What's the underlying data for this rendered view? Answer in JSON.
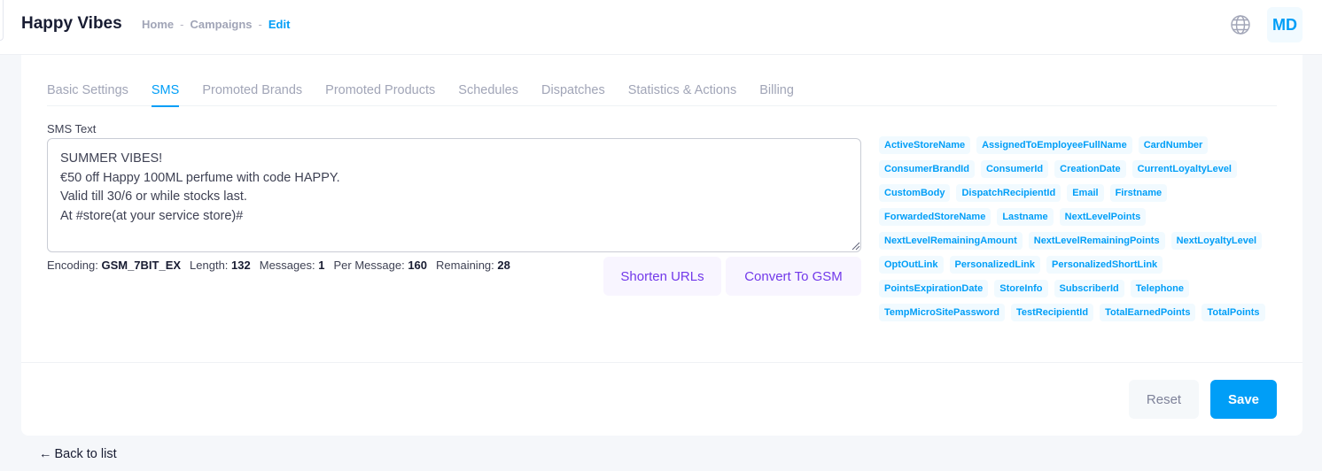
{
  "header": {
    "app_title": "Happy Vibes",
    "breadcrumb": [
      "Home",
      "Campaigns",
      "Edit"
    ],
    "separator": "-",
    "language_icon": "globe-icon",
    "avatar_initials": "MD"
  },
  "tabs": [
    {
      "label": "Basic Settings",
      "active": false
    },
    {
      "label": "SMS",
      "active": true
    },
    {
      "label": "Promoted Brands",
      "active": false
    },
    {
      "label": "Promoted Products",
      "active": false
    },
    {
      "label": "Schedules",
      "active": false
    },
    {
      "label": "Dispatches",
      "active": false
    },
    {
      "label": "Statistics & Actions",
      "active": false
    },
    {
      "label": "Billing",
      "active": false
    }
  ],
  "sms": {
    "label": "SMS Text",
    "text": "SUMMER VIBES!\n€50 off Happy 100ML perfume with code HAPPY.\nValid till 30/6 or while stocks last.\nAt #store(at your service store)#"
  },
  "stats": {
    "encoding_label": "Encoding:",
    "encoding_value": "GSM_7BIT_EX",
    "length_label": "Length:",
    "length_value": "132",
    "messages_label": "Messages:",
    "messages_value": "1",
    "per_message_label": "Per Message:",
    "per_message_value": "160",
    "remaining_label": "Remaining:",
    "remaining_value": "28"
  },
  "actions": {
    "shorten_urls": "Shorten URLs",
    "convert_to_gsm": "Convert To GSM",
    "reset": "Reset",
    "save": "Save"
  },
  "placeholders": [
    "ActiveStoreName",
    "AssignedToEmployeeFullName",
    "CardNumber",
    "ConsumerBrandId",
    "ConsumerId",
    "CreationDate",
    "CurrentLoyaltyLevel",
    "CustomBody",
    "DispatchRecipientId",
    "Email",
    "Firstname",
    "ForwardedStoreName",
    "Lastname",
    "NextLevelPoints",
    "NextLevelRemainingAmount",
    "NextLevelRemainingPoints",
    "NextLoyaltyLevel",
    "OptOutLink",
    "PersonalizedLink",
    "PersonalizedShortLink",
    "PointsExpirationDate",
    "StoreInfo",
    "SubscriberId",
    "Telephone",
    "TempMicroSitePassword",
    "TestRecipientId",
    "TotalEarnedPoints",
    "TotalPoints"
  ],
  "footer": {
    "back_arrow": "←",
    "back_label": "Back to list"
  },
  "colors": {
    "primary": "#009ef7",
    "accent_purple": "#7239ea",
    "muted": "#a1a5b7"
  }
}
